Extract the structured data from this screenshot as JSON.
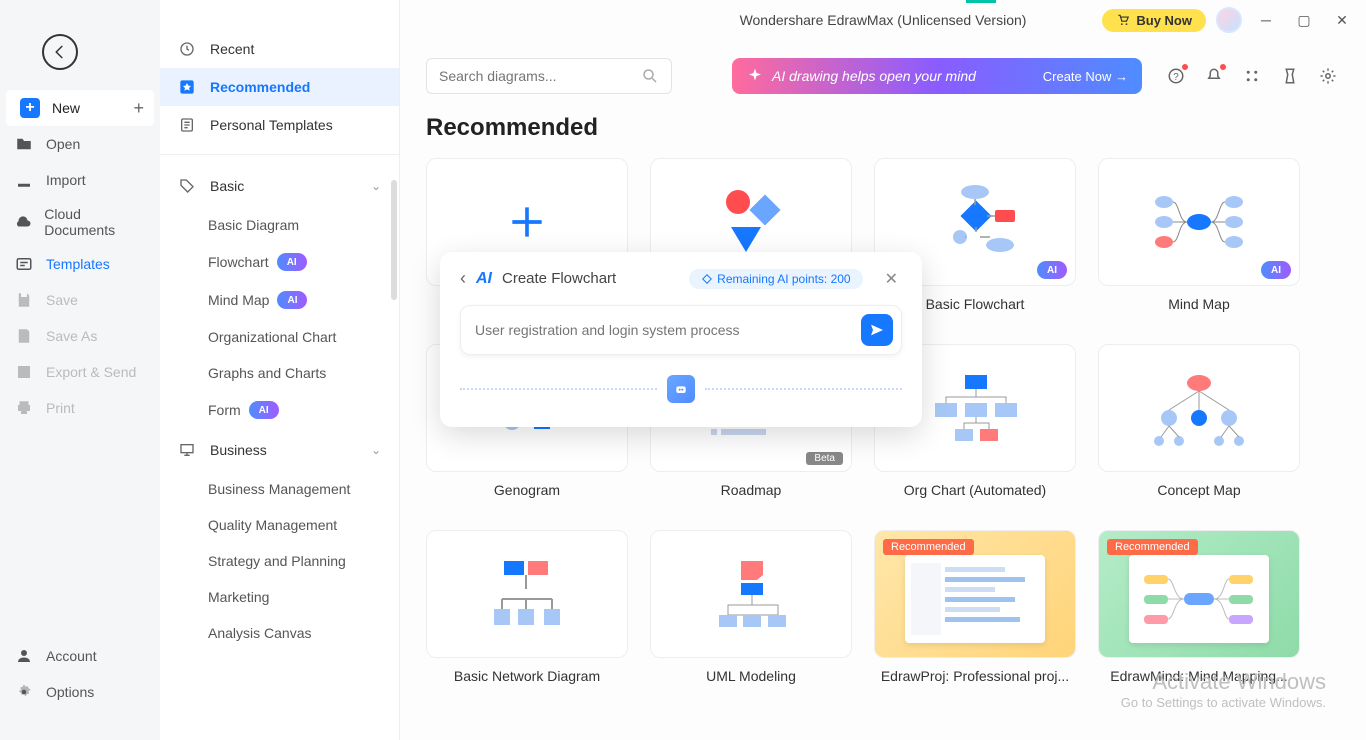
{
  "app_title": "Wondershare EdrawMax (Unlicensed Version)",
  "buy_now": "Buy Now",
  "far_sidebar": {
    "new": "New",
    "open": "Open",
    "import": "Import",
    "cloud": "Cloud Documents",
    "templates": "Templates",
    "save": "Save",
    "save_as": "Save As",
    "export": "Export & Send",
    "print": "Print",
    "account": "Account",
    "options": "Options"
  },
  "nav": {
    "recent": "Recent",
    "recommended": "Recommended",
    "personal": "Personal Templates",
    "basic": "Basic",
    "basic_items": {
      "basic_diagram": "Basic Diagram",
      "flowchart": "Flowchart",
      "mind_map": "Mind Map",
      "org_chart": "Organizational Chart",
      "graphs": "Graphs and Charts",
      "form": "Form"
    },
    "business": "Business",
    "business_items": {
      "bm": "Business Management",
      "qm": "Quality Management",
      "sp": "Strategy and Planning",
      "mk": "Marketing",
      "ac": "Analysis Canvas"
    }
  },
  "search_placeholder": "Search diagrams...",
  "ai_banner": {
    "text": "AI drawing helps open your mind",
    "cta": "Create Now  →"
  },
  "section_title": "Recommended",
  "cards": {
    "blank": "",
    "basic_flowchart": "Basic Flowchart",
    "mind_map": "Mind Map",
    "genogram": "Genogram",
    "roadmap": "Roadmap",
    "org_auto": "Org Chart (Automated)",
    "concept": "Concept Map",
    "network": "Basic Network Diagram",
    "uml": "UML Modeling",
    "edrawproj": "EdrawProj: Professional proj...",
    "edrawmind": "EdrawMind: Mind Mapping..."
  },
  "beta": "Beta",
  "recommended_tag": "Recommended",
  "ai_label": "AI",
  "popup": {
    "title": "Create Flowchart",
    "remaining": "Remaining AI points: 200",
    "placeholder": "User registration and login system process"
  },
  "watermark": {
    "l1": "Activate Windows",
    "l2": "Go to Settings to activate Windows."
  }
}
